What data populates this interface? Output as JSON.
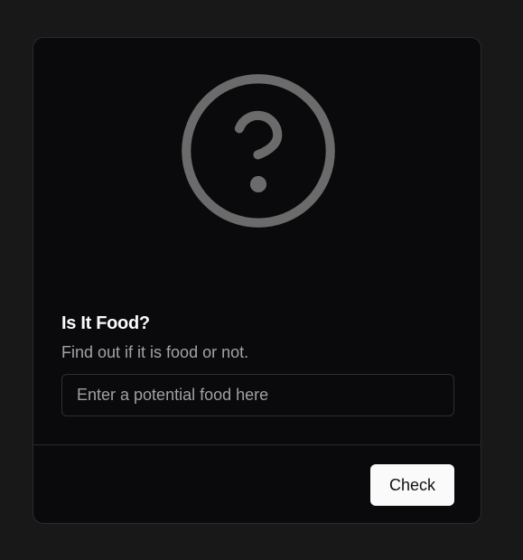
{
  "card": {
    "title": "Is It Food?",
    "subtitle": "Find out if it is food or not.",
    "icon": "question-circle-icon"
  },
  "input": {
    "placeholder": "Enter a potential food here",
    "value": ""
  },
  "footer": {
    "check_label": "Check"
  },
  "colors": {
    "page_background": "#181818",
    "card_background": "#0a0a0c",
    "icon": "#6b6b6b",
    "button_background": "#fafafa"
  }
}
